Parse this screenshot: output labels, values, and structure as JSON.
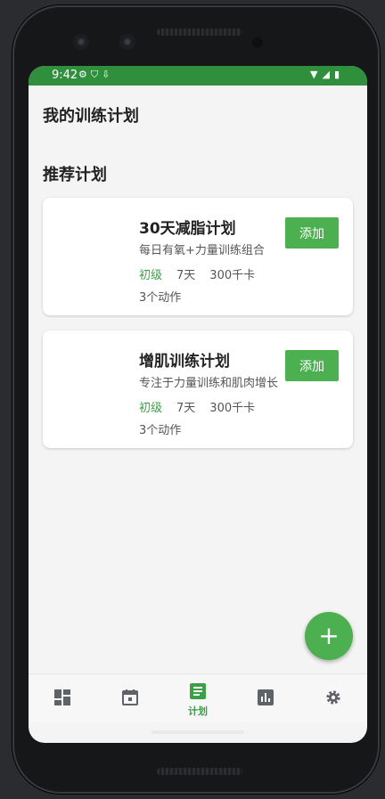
{
  "status": {
    "time": "9:42"
  },
  "header": {
    "title": "我的训练计划"
  },
  "section": {
    "title": "推荐计划"
  },
  "plans": [
    {
      "title": "30天减脂计划",
      "description": "每日有氧+力量训练组合",
      "level": "初级",
      "days": "7天",
      "calories": "300千卡",
      "count": "3个动作",
      "add_label": "添加"
    },
    {
      "title": "增肌训练计划",
      "description": "专注于力量训练和肌肉增长",
      "level": "初级",
      "days": "7天",
      "calories": "300千卡",
      "count": "3个动作",
      "add_label": "添加"
    }
  ],
  "fab": {
    "symbol": "+"
  },
  "nav": {
    "active_label": "计划",
    "items": [
      "dashboard-icon",
      "calendar-icon",
      "plan-icon",
      "stats-icon",
      "settings-icon"
    ]
  },
  "colors": {
    "accent": "#4caf50",
    "statusbar": "#2f8f3c",
    "level": "#3aa146"
  }
}
